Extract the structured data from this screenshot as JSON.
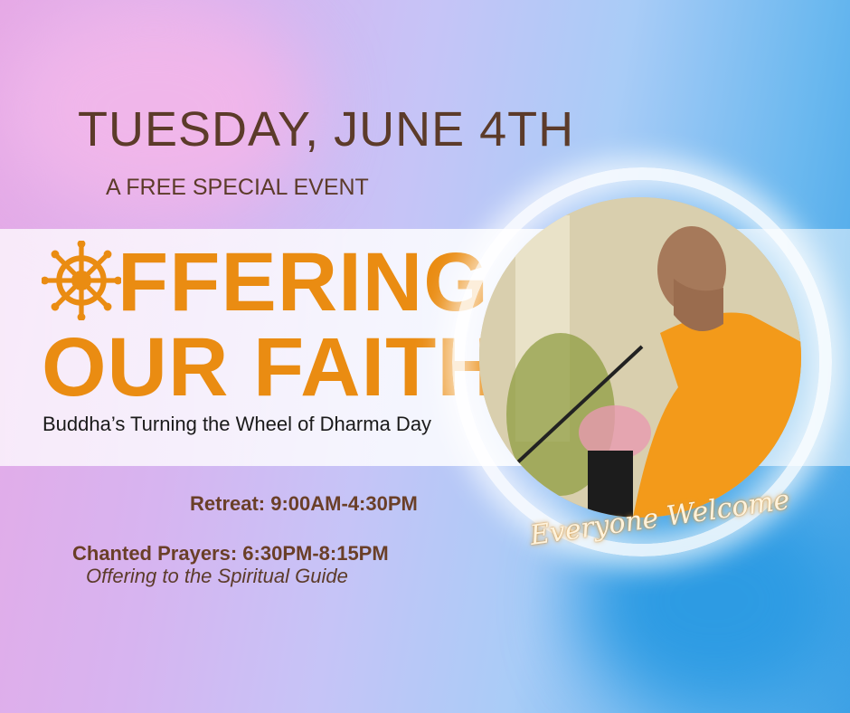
{
  "date": "TUESDAY, JUNE 4TH",
  "tagline": "A FREE SPECIAL EVENT",
  "title_line1": "FFERING",
  "title_line2": "OUR FAITH",
  "title_icon": "dharma-wheel-icon",
  "subtitle": "Buddha’s Turning the Wheel of Dharma Day",
  "retreat": "Retreat: 9:00AM-4:30PM",
  "chanted": "Chanted Prayers: 6:30PM-8:15PM",
  "chanted_sub": "Offering to the Spiritual Guide",
  "welcome": "Everyone Welcome",
  "colors": {
    "accent": "#ea8c12",
    "text": "#5c3b2a",
    "robe": "#f39a1a"
  }
}
